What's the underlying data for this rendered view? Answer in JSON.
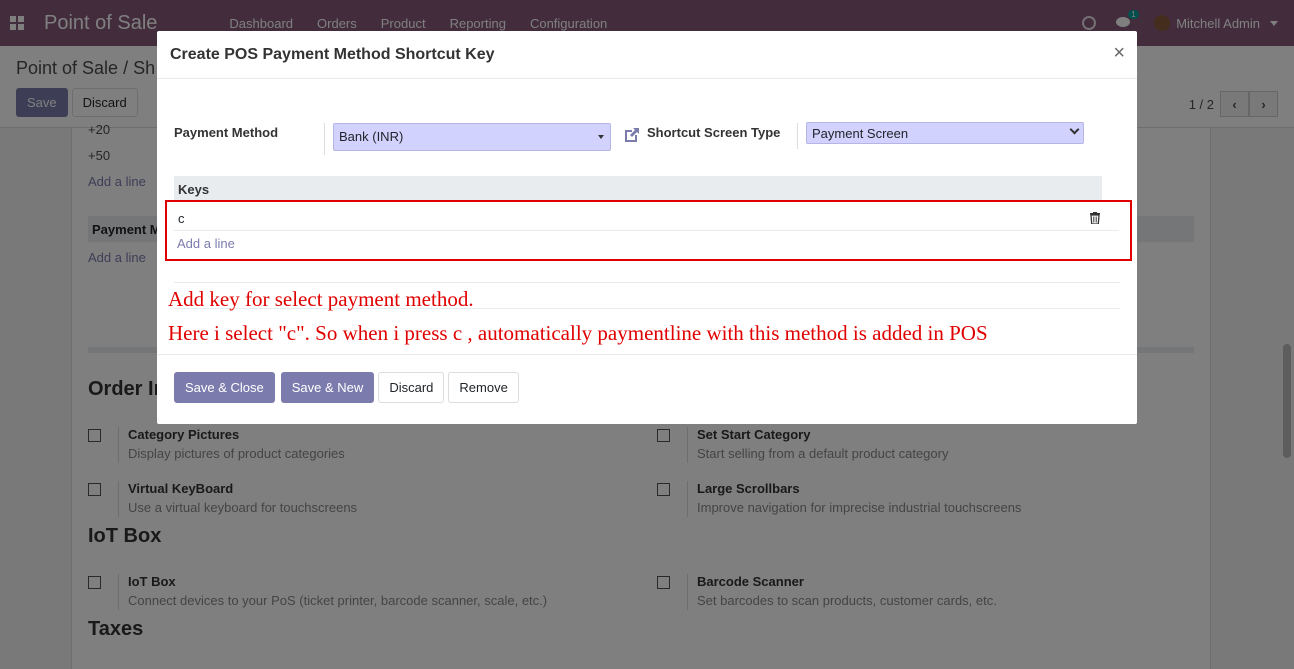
{
  "navbar": {
    "brand": "Point of Sale",
    "menu": [
      "Dashboard",
      "Orders",
      "Product",
      "Reporting",
      "Configuration"
    ],
    "chat_count": "1",
    "user_name": "Mitchell Admin"
  },
  "control_panel": {
    "breadcrumb": "Point of Sale / Sh",
    "save_label": "Save",
    "discard_label": "Discard",
    "pager": "1 / 2"
  },
  "background": {
    "rows": [
      "+20",
      "+50"
    ],
    "add_line": "Add a line",
    "payment_header": "Payment M",
    "add_line_2": "Add a line",
    "section_order": "Order In",
    "section_iot": "IoT Box",
    "section_taxes": "Taxes",
    "settings": [
      {
        "title": "Category Pictures",
        "desc": "Display pictures of product categories"
      },
      {
        "title": "Set Start Category",
        "desc": "Start selling from a default product category"
      },
      {
        "title": "Virtual KeyBoard",
        "desc": "Use a virtual keyboard for touchscreens"
      },
      {
        "title": "Large Scrollbars",
        "desc": "Improve navigation for imprecise industrial touchscreens"
      },
      {
        "title": "IoT Box",
        "desc": "Connect devices to your PoS (ticket printer, barcode scanner, scale, etc.)"
      },
      {
        "title": "Barcode Scanner",
        "desc": "Set barcodes to scan products, customer cards, etc."
      }
    ]
  },
  "modal": {
    "title": "Create POS Payment Method Shortcut Key",
    "close": "×",
    "payment_method_label": "Payment Method",
    "payment_method_value": "Bank (INR)",
    "screen_type_label": "Shortcut Screen Type",
    "screen_type_value": "Payment Screen",
    "keys_header": "Keys",
    "keys": [
      "c"
    ],
    "add_line": "Add a line",
    "annotation_1": "Add key for select payment method.",
    "annotation_2": "Here i select \"c\". So when i press c , automatically paymentline with this method is added in POS",
    "buttons": {
      "save_close": "Save & Close",
      "save_new": "Save & New",
      "discard": "Discard",
      "remove": "Remove"
    }
  },
  "colors": {
    "navbar": "#875a7b",
    "primary": "#7c7bad",
    "annotation": "#e00000",
    "select_bg": "#d2d2ff"
  }
}
